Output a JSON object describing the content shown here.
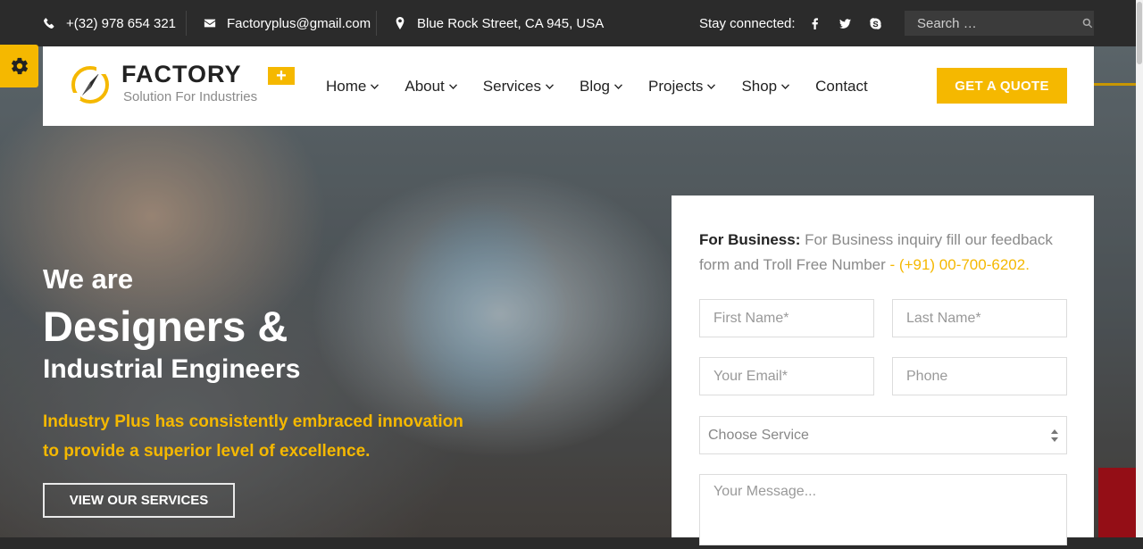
{
  "topbar": {
    "phone": "+(32) 978 654 321",
    "email": "Factoryplus@gmail.com",
    "address": "Blue Rock Street, CA 945, USA",
    "stay_connected": "Stay connected:",
    "social_icons": [
      "facebook-icon",
      "twitter-icon",
      "skype-icon"
    ],
    "search_placeholder": "Search …"
  },
  "header": {
    "brand": "FACTORY",
    "brand_badge": "+",
    "tagline": "Solution For Industries",
    "nav": [
      {
        "label": "Home",
        "has_dropdown": true
      },
      {
        "label": "About",
        "has_dropdown": true
      },
      {
        "label": "Services",
        "has_dropdown": true
      },
      {
        "label": "Blog",
        "has_dropdown": true
      },
      {
        "label": "Projects",
        "has_dropdown": true
      },
      {
        "label": "Shop",
        "has_dropdown": true
      },
      {
        "label": "Contact",
        "has_dropdown": false
      }
    ],
    "cta": "GET A QUOTE"
  },
  "hero": {
    "line1": "We are",
    "line2": "Designers &",
    "line3": "Industrial Engineers",
    "description": "Industry Plus has consistently embraced innovation to provide a superior level of excellence.",
    "button": "VIEW OUR SERVICES"
  },
  "form": {
    "intro_label": "For Business:",
    "intro_text": " For Business inquiry fill our feedback form and Troll Free Number",
    "intro_phone": " - (+91) 00-700-6202.",
    "first_name_placeholder": "First Name*",
    "last_name_placeholder": "Last Name*",
    "email_placeholder": "Your Email*",
    "phone_placeholder": "Phone",
    "service_selected": "Choose Service",
    "message_placeholder": "Your Message..."
  },
  "colors": {
    "accent": "#f5b800",
    "dark": "#2b2b2b",
    "red": "#b5121b"
  }
}
